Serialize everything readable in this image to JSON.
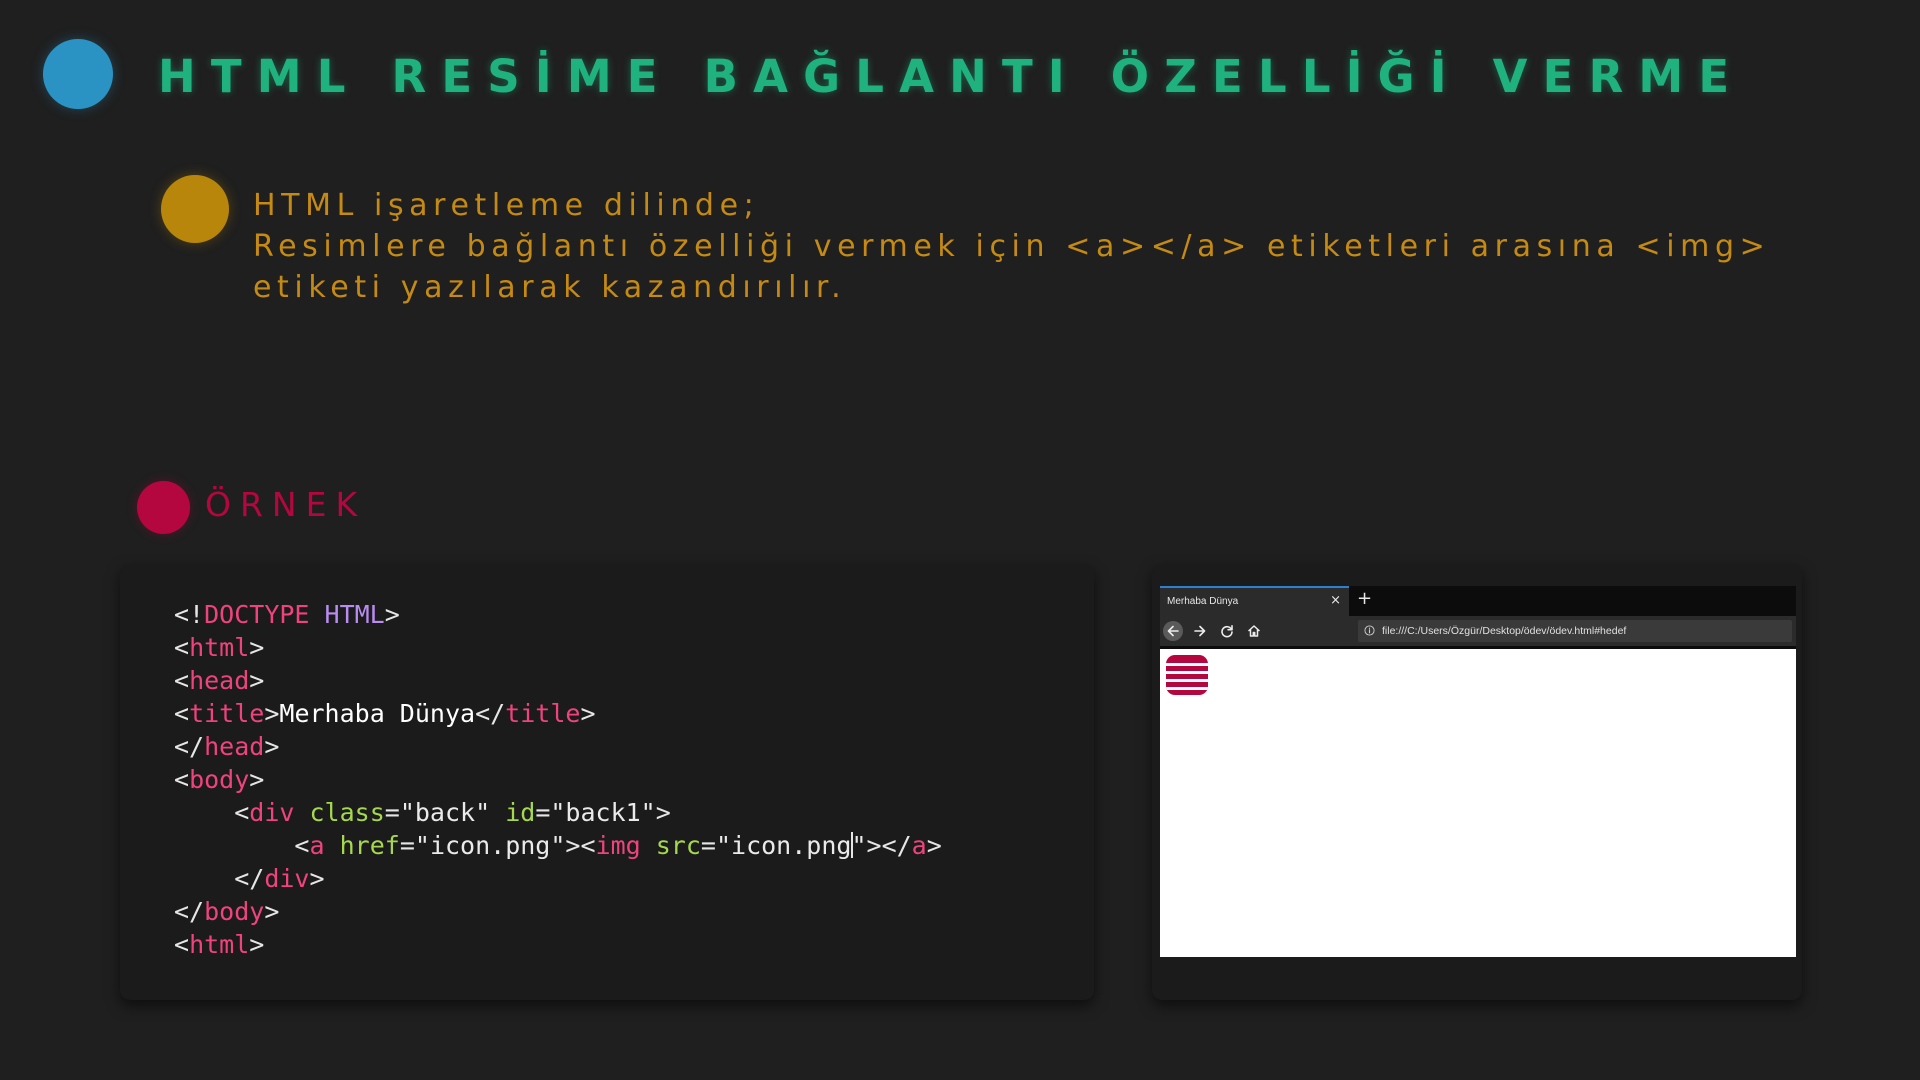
{
  "slide": {
    "title": "HTML RESİME BAĞLANTI ÖZELLİĞİ VERME",
    "body_lines": [
      "HTML işaretleme dilinde;",
      "Resimlere bağlantı özelliği vermek için <a></a> etiketleri arasına <img>",
      "etiketi yazılarak kazandırılır."
    ],
    "section_label": "ÖRNEK",
    "colors": {
      "background": "#1f1f1f",
      "title": "#1fb27f",
      "body_text": "#c48a14",
      "section_label": "#b5073f",
      "dot_blue": "#2a93c3",
      "dot_gold": "#b8860b",
      "dot_red": "#b5073f"
    }
  },
  "code": {
    "doctype_open": "<!",
    "doctype_kw": "DOCTYPE",
    "doctype_html": "HTML",
    "lt": "<",
    "gt": ">",
    "lt_slash": "</",
    "eq": "=",
    "space": " ",
    "indent1": "    ",
    "indent2": "        ",
    "tag_html": "html",
    "tag_head": "head",
    "tag_title": "title",
    "title_text": "Merhaba Dünya",
    "tag_body": "body",
    "tag_div": "div",
    "attr_class": "class",
    "val_back": "\"back\"",
    "attr_id": "id",
    "val_back1": "\"back1\"",
    "tag_a": "a",
    "attr_href": "href",
    "val_icon": "\"icon.png\"",
    "tag_img": "img",
    "attr_src": "src",
    "val_src_open": "\"icon.png",
    "quote": "\""
  },
  "browser": {
    "tab_title": "Merhaba Dünya",
    "tab_close_icon": "×",
    "new_tab_icon": "+",
    "url": "file:///C:/Users/Özgür/Desktop/ödev/ödev.html#hedef",
    "icons": [
      "back-arrow-icon",
      "forward-arrow-icon",
      "reload-icon",
      "home-icon",
      "info-icon",
      "striped-image-icon"
    ],
    "page_icon_color": "#b5073f",
    "tab_accent_color": "#2f7fd1"
  }
}
